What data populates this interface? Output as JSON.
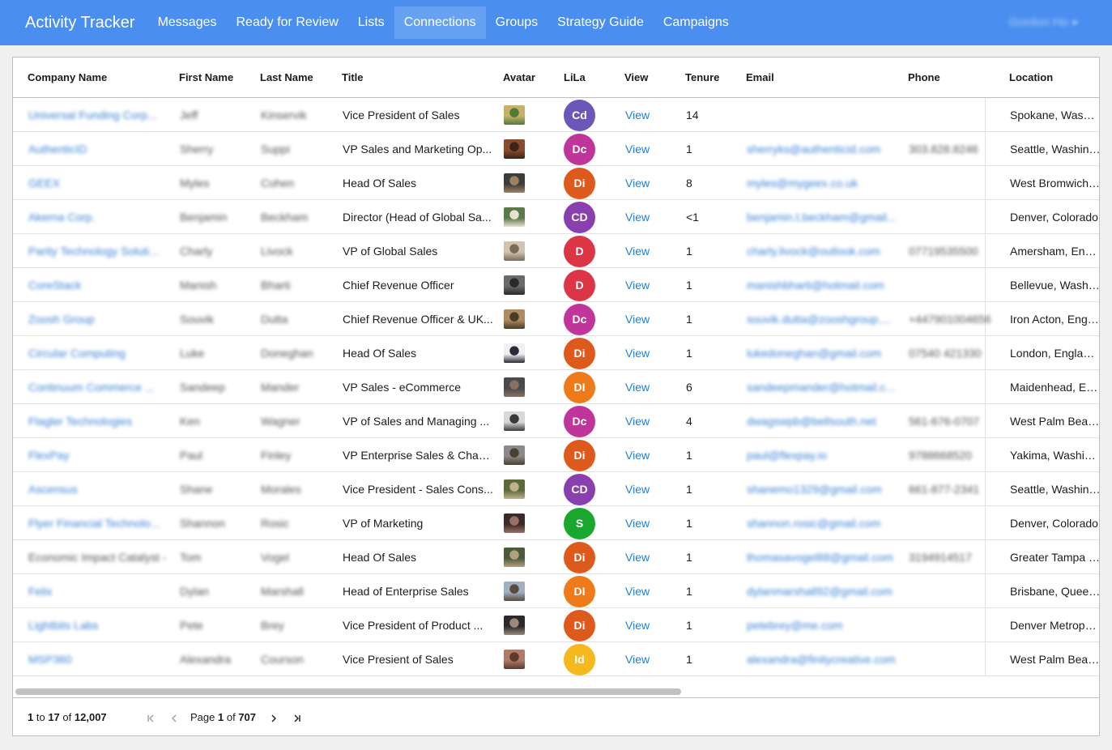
{
  "nav": {
    "brand": "Activity Tracker",
    "items": [
      "Messages",
      "Ready for Review",
      "Lists",
      "Connections",
      "Groups",
      "Strategy Guide",
      "Campaigns"
    ],
    "active_index": 3,
    "user": "Gordon Ho"
  },
  "colors": {
    "navbar": "#4a8ff0",
    "link": "#3b82d6",
    "badge_purple": "#6b57b8",
    "badge_magenta": "#c0359a",
    "badge_orange_red": "#dd5a1c",
    "badge_orange": "#ee7a1a",
    "badge_red": "#dc3545",
    "badge_green": "#1aa72e",
    "badge_yellow": "#f6b91d"
  },
  "table": {
    "columns": [
      "Company Name",
      "First Name",
      "Last Name",
      "Title",
      "Avatar",
      "LiLa",
      "View",
      "Tenure",
      "Email",
      "Phone",
      "Location"
    ],
    "rows": [
      {
        "company": "Universal Funding Corp...",
        "company_link": true,
        "first": "Jeff",
        "last": "Kinservik",
        "title": "Vice President of Sales",
        "badge": "Cd",
        "badge_color": "#6b57b8",
        "view": "View",
        "tenure": "14",
        "email": "",
        "phone": "",
        "location": "Spokane, Washington"
      },
      {
        "company": "AuthenticID",
        "company_link": true,
        "first": "Sherry",
        "last": "Suppi",
        "title": "VP Sales and Marketing Op...",
        "badge": "Dc",
        "badge_color": "#c0359a",
        "view": "View",
        "tenure": "1",
        "email": "sherryks@authenticid.com",
        "phone": "303.828.8246",
        "location": "Seattle, Washington"
      },
      {
        "company": "GEEX",
        "company_link": true,
        "first": "Myles",
        "last": "Cohen",
        "title": "Head Of Sales",
        "badge": "Di",
        "badge_color": "#dd5a1c",
        "view": "View",
        "tenure": "8",
        "email": "myles@mygeex.co.uk",
        "phone": "",
        "location": "West Bromwich, England"
      },
      {
        "company": "Akerna Corp.",
        "company_link": true,
        "first": "Benjamin",
        "last": "Beckham",
        "title": "Director (Head of Global Sa...",
        "badge": "CD",
        "badge_color": "#8a3fb0",
        "view": "View",
        "tenure": "<1",
        "email": "benjamin.t.beckham@gmail...",
        "phone": "",
        "location": "Denver, Colorado"
      },
      {
        "company": "Parity Technology Soluti...",
        "company_link": true,
        "first": "Charly",
        "last": "Livock",
        "title": "VP of Global Sales",
        "badge": "D",
        "badge_color": "#dc3545",
        "view": "View",
        "tenure": "1",
        "email": "charly.livock@outlook.com",
        "phone": "07719535500",
        "location": "Amersham, England"
      },
      {
        "company": "CoreStack",
        "company_link": true,
        "first": "Manish",
        "last": "Bharti",
        "title": "Chief Revenue Officer",
        "badge": "D",
        "badge_color": "#dc3545",
        "view": "View",
        "tenure": "1",
        "email": "manishbharti@hotmail.com",
        "phone": "",
        "location": "Bellevue, Washington"
      },
      {
        "company": "Zoosh Group",
        "company_link": true,
        "first": "Souvik",
        "last": "Dutta",
        "title": "Chief Revenue Officer & UK...",
        "badge": "Dc",
        "badge_color": "#c0359a",
        "view": "View",
        "tenure": "1",
        "email": "souvik.dutta@zooshgroup....",
        "phone": "+447901004656",
        "location": "Iron Acton, England"
      },
      {
        "company": "Circular Computing",
        "company_link": true,
        "first": "Luke",
        "last": "Doneghan",
        "title": "Head Of Sales",
        "badge": "Di",
        "badge_color": "#dd5a1c",
        "view": "View",
        "tenure": "1",
        "email": "lukedoneghan@gmail.com",
        "phone": "07540 421330",
        "location": "London, England, United Kingdom"
      },
      {
        "company": "Continuum Commerce ...",
        "company_link": true,
        "first": "Sandeep",
        "last": "Mander",
        "title": "VP Sales - eCommerce",
        "badge": "DI",
        "badge_color": "#ee7a1a",
        "view": "View",
        "tenure": "6",
        "email": "sandeepmander@hotmail.c...",
        "phone": "",
        "location": "Maidenhead, England"
      },
      {
        "company": "Flagler Technologies",
        "company_link": true,
        "first": "Ken",
        "last": "Wagner",
        "title": "VP of Sales and Managing ...",
        "badge": "Dc",
        "badge_color": "#c0359a",
        "view": "View",
        "tenure": "4",
        "email": "dwagswpb@bellsouth.net",
        "phone": "561-676-0707",
        "location": "West Palm Beach, Florida"
      },
      {
        "company": "FlexPay",
        "company_link": true,
        "first": "Paul",
        "last": "Finley",
        "title": "VP Enterprise Sales & Chan...",
        "badge": "Di",
        "badge_color": "#dd5a1c",
        "view": "View",
        "tenure": "1",
        "email": "paul@flexpay.io",
        "phone": "9788668520",
        "location": "Yakima, Washington"
      },
      {
        "company": "Ascensus",
        "company_link": true,
        "first": "Shane",
        "last": "Morales",
        "title": "Vice President - Sales Cons...",
        "badge": "CD",
        "badge_color": "#8a3fb0",
        "view": "View",
        "tenure": "1",
        "email": "shanemo1329@gmail.com",
        "phone": "661-877-2341",
        "location": "Seattle, Washington"
      },
      {
        "company": "Flyer Financial Technolo...",
        "company_link": true,
        "first": "Shannon",
        "last": "Rosic",
        "title": "VP of Marketing",
        "badge": "S",
        "badge_color": "#1aa72e",
        "view": "View",
        "tenure": "1",
        "email": "shannon.rosic@gmail.com",
        "phone": "",
        "location": "Denver, Colorado"
      },
      {
        "company": "Economic Impact Catalyst - ",
        "company_link": false,
        "first": "Tom",
        "last": "Vogel",
        "title": "Head Of Sales",
        "badge": "Di",
        "badge_color": "#dd5a1c",
        "view": "View",
        "tenure": "1",
        "email": "thomasavogel88@gmail.com",
        "phone": "3194914517",
        "location": "Greater Tampa Bay Area"
      },
      {
        "company": "Felix",
        "company_link": true,
        "first": "Dylan",
        "last": "Marshall",
        "title": "Head of Enterprise Sales",
        "badge": "DI",
        "badge_color": "#ee7a1a",
        "view": "View",
        "tenure": "1",
        "email": "dylanmarshall92@gmail.com",
        "phone": "",
        "location": "Brisbane, Queensland"
      },
      {
        "company": "Lightbits Labs",
        "company_link": true,
        "first": "Pete",
        "last": "Brey",
        "title": "Vice President of Product ...",
        "badge": "Di",
        "badge_color": "#dd5a1c",
        "view": "View",
        "tenure": "1",
        "email": "petebrey@me.com",
        "phone": "",
        "location": "Denver Metropolitan Area"
      },
      {
        "company": "MSP360",
        "company_link": true,
        "first": "Alexandra",
        "last": "Courson",
        "title": "Vice Presient of Sales",
        "badge": "Id",
        "badge_color": "#f6b91d",
        "view": "View",
        "tenure": "1",
        "email": "alexandra@finitycreative.com",
        "phone": "",
        "location": "West Palm Beach, Florida"
      }
    ]
  },
  "paging": {
    "from": "1",
    "to_word": "to",
    "to": "17",
    "of_word": "of",
    "total": "12,007",
    "page_word": "Page",
    "page": "1",
    "page_of_word": "of",
    "pages": "707"
  }
}
